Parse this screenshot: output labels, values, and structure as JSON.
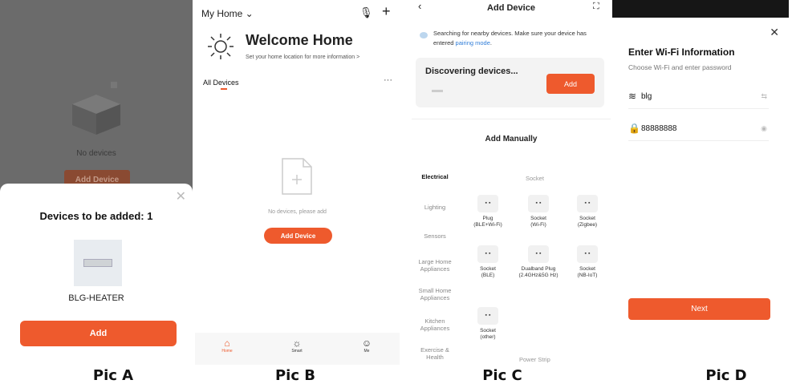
{
  "captions": [
    "Pic A",
    "Pic B",
    "Pic C",
    "Pic D"
  ],
  "accent_color": "#ee5a2d",
  "pic_a": {
    "background_empty_text": "No devices",
    "background_add_button": "Add Device",
    "sheet_title": "Devices to be added: 1",
    "device_name": "BLG-HEATER",
    "add_button": "Add"
  },
  "pic_b": {
    "home_selector": "My Home ⌄",
    "welcome_title": "Welcome Home",
    "location_hint": "Set your home location for more information  >",
    "all_devices_tab": "All Devices",
    "more_menu": "···",
    "empty_text": "No devices, please add",
    "add_device_button": "Add Device",
    "tabs": [
      {
        "label": "Home",
        "icon": "home-icon"
      },
      {
        "label": "Smart",
        "icon": "sun-icon"
      },
      {
        "label": "Me",
        "icon": "profile-icon"
      }
    ]
  },
  "pic_c": {
    "header_title": "Add Device",
    "search_text": "Searching for nearby devices. Make sure your device has entered ",
    "pairing_link": "pairing mode",
    "discovering_title": "Discovering devices...",
    "discovering_add": "Add",
    "add_manually_title": "Add Manually",
    "categories": [
      "Electrical",
      "Lighting",
      "Sensors",
      "Large Home Appliances",
      "Small Home Appliances",
      "Kitchen Appliances",
      "Exercise & Health"
    ],
    "section_socket": "Socket",
    "section_power_strip": "Power Strip",
    "devices": [
      {
        "label": "Plug\n(BLE+Wi-Fi)"
      },
      {
        "label": "Socket\n(Wi-Fi)"
      },
      {
        "label": "Socket\n(Zigbee)"
      },
      {
        "label": "Socket\n(BLE)"
      },
      {
        "label": "Dualband Plug\n(2.4GHz&5G Hz)"
      },
      {
        "label": "Socket\n(NB-IoT)"
      },
      {
        "label": "Socket\n(other)"
      }
    ]
  },
  "pic_d": {
    "title": "Enter Wi-Fi Information",
    "subtitle": "Choose Wi-Fi and enter password",
    "wifi_name": "blg",
    "password": "88888888",
    "next_button": "Next"
  }
}
